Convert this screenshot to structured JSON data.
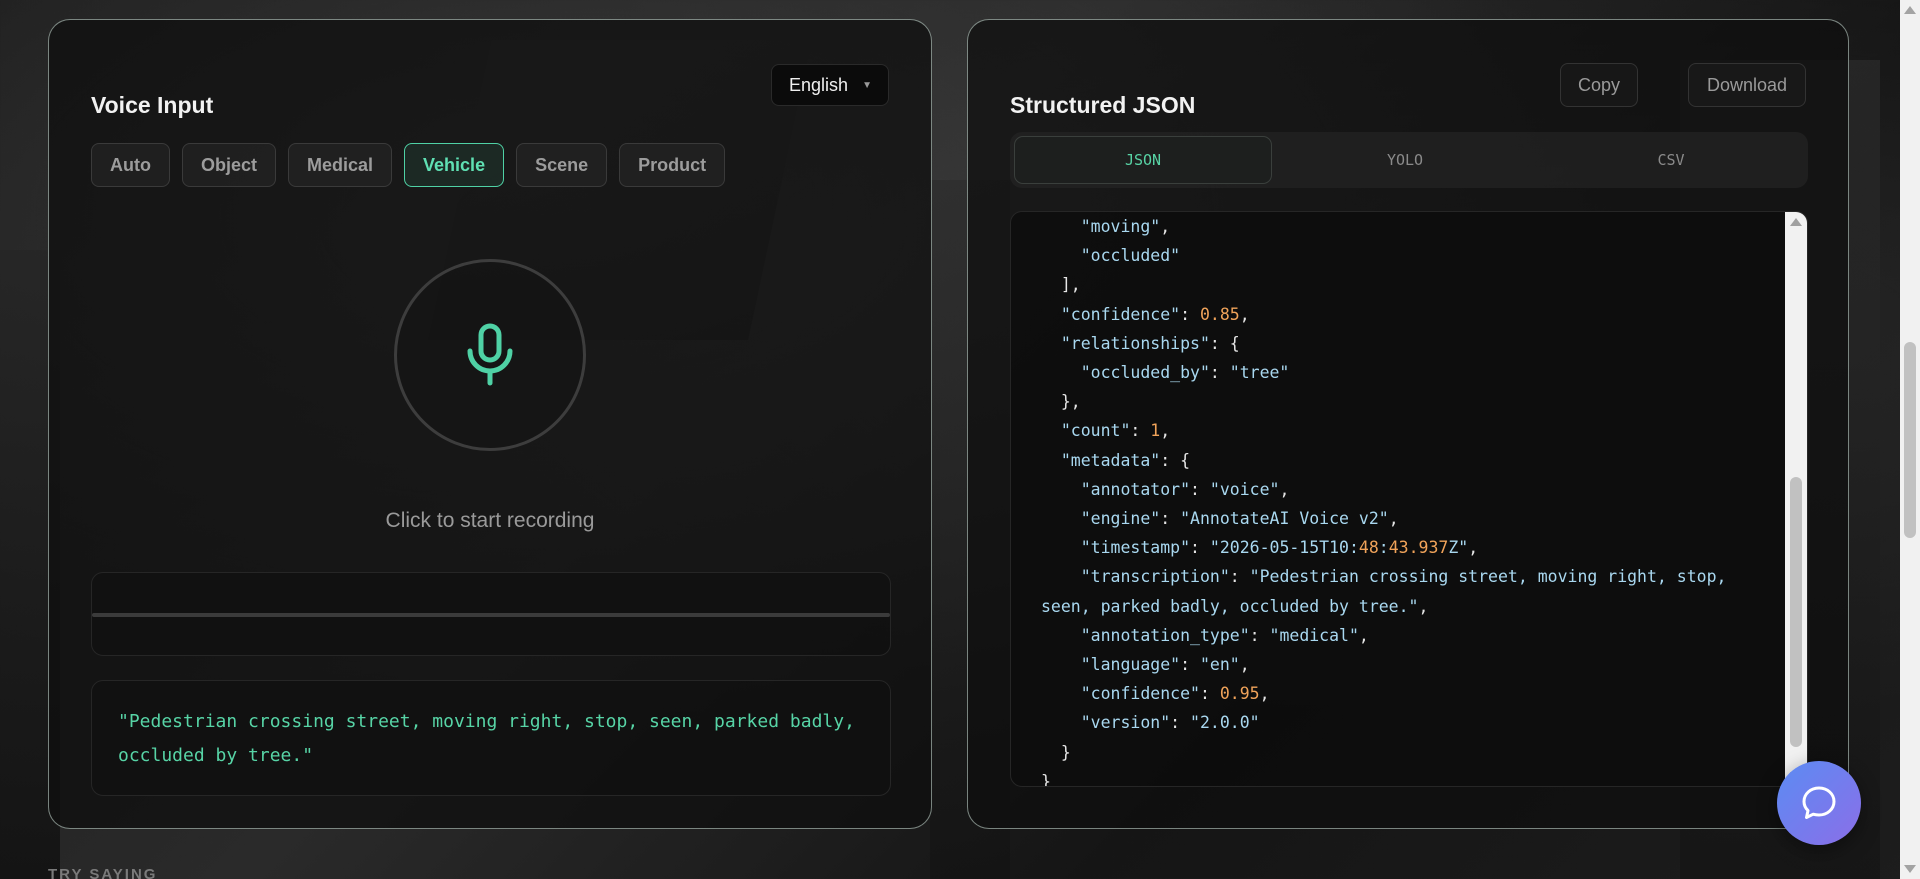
{
  "voice_panel": {
    "title": "Voice Input",
    "language": "English",
    "types": [
      "Auto",
      "Object",
      "Medical",
      "Vehicle",
      "Scene",
      "Product"
    ],
    "active_type": "Vehicle",
    "record_hint": "Click to start recording",
    "transcript": "\"Pedestrian crossing street, moving right, stop, seen, parked badly, occluded by tree.\""
  },
  "json_panel": {
    "title": "Structured JSON",
    "copy_label": "Copy",
    "download_label": "Download",
    "tabs": [
      "JSON",
      "YOLO",
      "CSV"
    ],
    "active_tab": "JSON",
    "code_lines": [
      "    \"moving\",",
      "    \"occluded\"",
      "  ],",
      "  \"confidence\": 0.85,",
      "  \"relationships\": {",
      "    \"occluded_by\": \"tree\"",
      "  },",
      "  \"count\": 1,",
      "  \"metadata\": {",
      "    \"annotator\": \"voice\",",
      "    \"engine\": \"AnnotateAI Voice v2\",",
      "    \"timestamp\": \"2026-05-15T10:48:43.937Z\",",
      "    \"transcription\": \"Pedestrian crossing street, moving right, stop, seen, parked badly, occluded by tree.\",",
      "    \"annotation_type\": \"medical\",",
      "    \"language\": \"en\",",
      "    \"confidence\": 0.95,",
      "    \"version\": \"2.0.0\"",
      "  }",
      "}"
    ]
  },
  "footer": {
    "try_saying": "TRY SAYING"
  },
  "icons": {
    "mic": "microphone-icon",
    "chat": "chat-bubble-icon",
    "dropdown": "chevron-down-icon"
  },
  "colors": {
    "accent": "#4fd1a5",
    "code_number": "#f0a35a",
    "code_string": "#a9d8f0",
    "fab_start": "#5b8cf3",
    "fab_end": "#8b6ee8"
  }
}
